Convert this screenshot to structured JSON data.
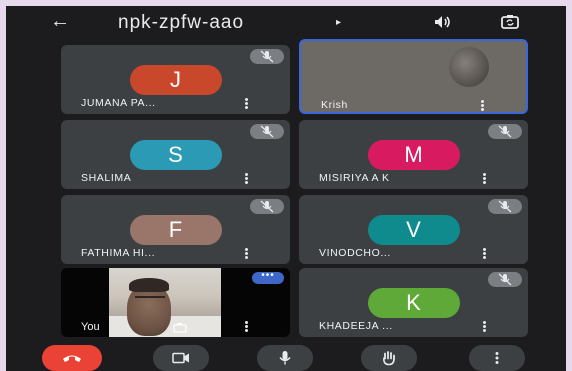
{
  "meeting": {
    "code": "npk-zpfw-aao",
    "back_icon": "arrow-left-icon",
    "info_icon": "triangle-right-icon"
  },
  "top_actions": [
    "speaker-icon",
    "camera-flip-icon"
  ],
  "participants": [
    {
      "name": "JUMANA PA...",
      "initial": "J",
      "color": "#c9472b",
      "muted": true
    },
    {
      "name": "Krish",
      "initial": "",
      "color": "",
      "muted": false,
      "video": true
    },
    {
      "name": "SHALIMA",
      "initial": "S",
      "color": "#2a9ab5",
      "muted": true
    },
    {
      "name": "MISIRIYA A K",
      "initial": "M",
      "color": "#d81b60",
      "muted": true
    },
    {
      "name": "FATHIMA HI...",
      "initial": "F",
      "color": "#9a7569",
      "muted": true
    },
    {
      "name": "VINODCHO...",
      "initial": "V",
      "color": "#0f8a8d",
      "muted": true
    },
    {
      "name": "You",
      "initial": "",
      "color": "",
      "muted": false,
      "video": true,
      "menu_label": "•••"
    },
    {
      "name": "KHADEEJA ...",
      "initial": "K",
      "color": "#5ea938",
      "muted": true
    }
  ],
  "controls": [
    {
      "name": "end-call",
      "icon": "phone-hangup-icon",
      "color": "#ea4335"
    },
    {
      "name": "camera",
      "icon": "camera-icon"
    },
    {
      "name": "microphone",
      "icon": "microphone-icon"
    },
    {
      "name": "raise-hand",
      "icon": "hand-icon"
    },
    {
      "name": "more",
      "icon": "more-vertical-icon"
    }
  ]
}
